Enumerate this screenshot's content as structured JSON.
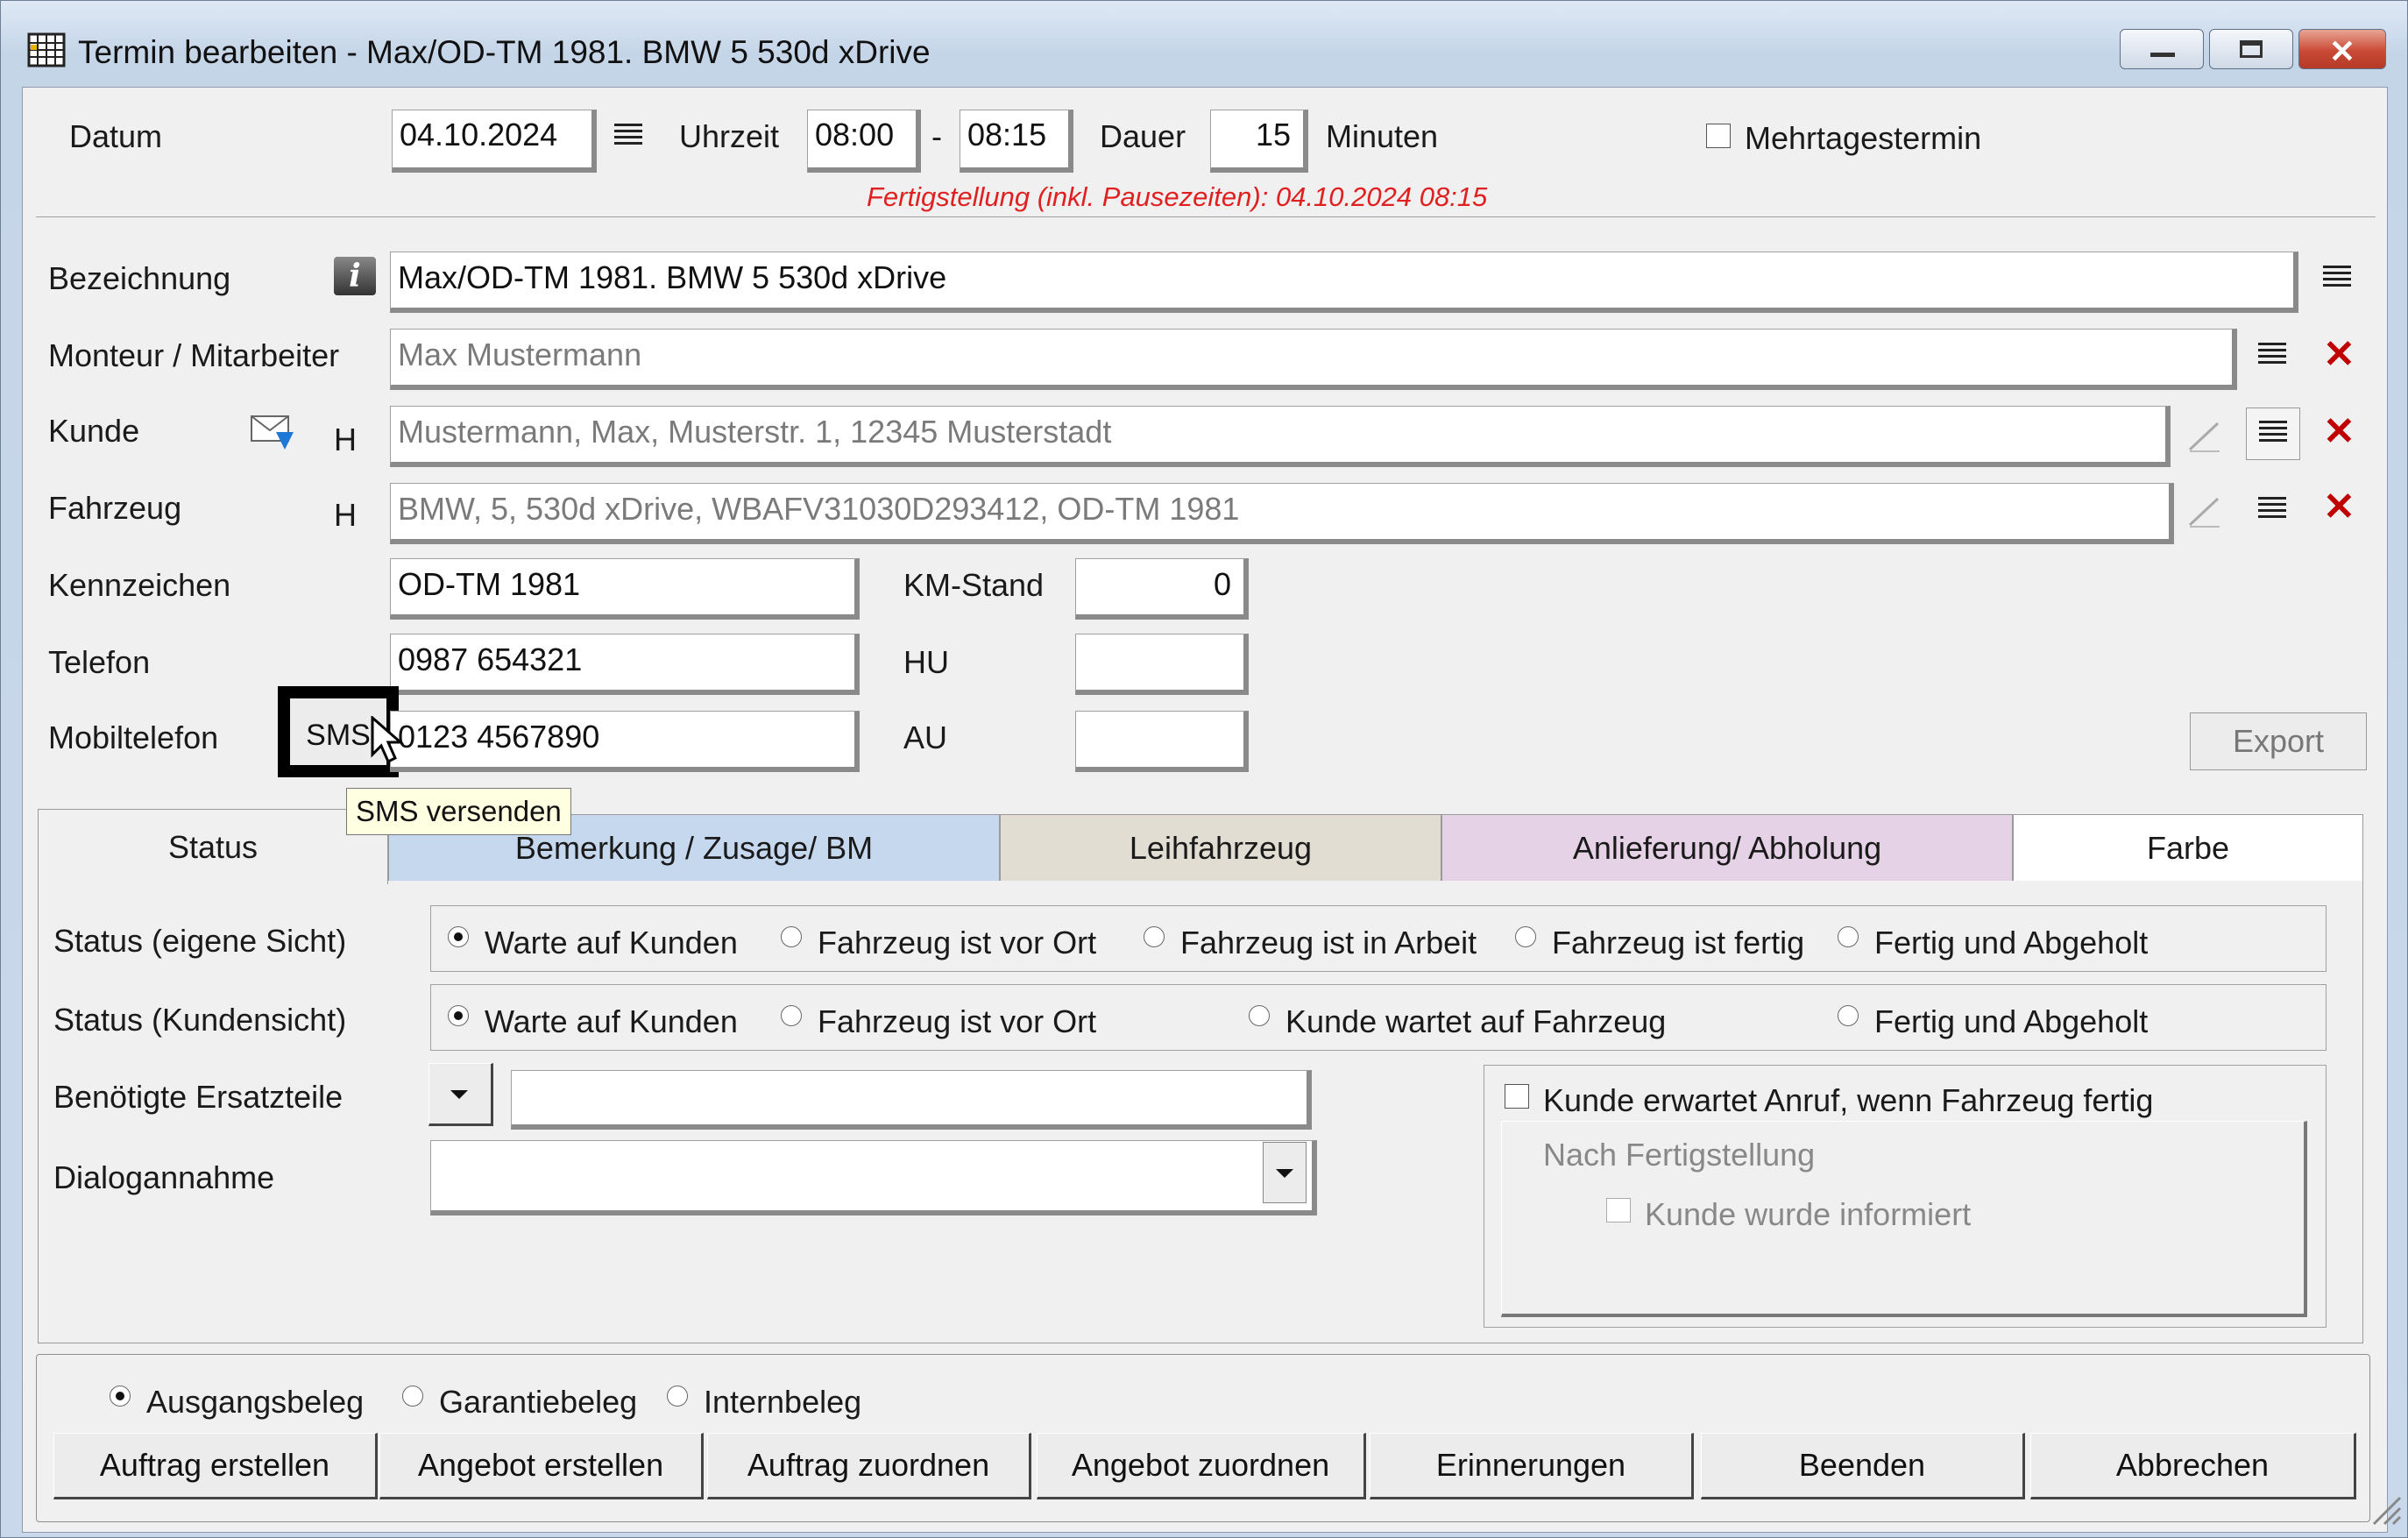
{
  "window": {
    "title": "Termin bearbeiten - Max/OD-TM 1981. BMW 5 530d xDrive"
  },
  "top": {
    "datum_label": "Datum",
    "datum_value": "04.10.2024",
    "uhrzeit_label": "Uhrzeit",
    "time_from": "08:00",
    "dash": "-",
    "time_to": "08:15",
    "dauer_label": "Dauer",
    "dauer_value": "15",
    "minuten_label": "Minuten",
    "mehrtages_label": "Mehrtagestermin",
    "fertigstellung": "Fertigstellung (inkl. Pausezeiten): 04.10.2024 08:15"
  },
  "form": {
    "bezeichnung_label": "Bezeichnung",
    "bezeichnung_value": "Max/OD-TM 1981. BMW 5 530d xDrive",
    "monteur_label": "Monteur / Mitarbeiter",
    "monteur_value": "Max Mustermann",
    "kunde_label": "Kunde",
    "kunde_h": "H",
    "kunde_value": "Mustermann, Max, Musterstr. 1, 12345 Musterstadt",
    "fahrzeug_label": "Fahrzeug",
    "fahrzeug_h": "H",
    "fahrzeug_value": "BMW, 5, 530d xDrive, WBAFV31030D293412, OD-TM 1981",
    "kennzeichen_label": "Kennzeichen",
    "kennzeichen_value": "OD-TM 1981",
    "kmstand_label": "KM-Stand",
    "kmstand_value": "0",
    "telefon_label": "Telefon",
    "telefon_value": "0987 654321",
    "hu_label": "HU",
    "mobil_label": "Mobiltelefon",
    "sms_button": "SMS",
    "mobil_value": "0123 4567890",
    "au_label": "AU",
    "export_button": "Export",
    "tooltip": "SMS versenden"
  },
  "tabs": [
    {
      "label": "Status",
      "color": "#f0f0f0"
    },
    {
      "label": "Bemerkung / Zusage/ BM",
      "color": "#c5d8ee"
    },
    {
      "label": "Leihfahrzeug",
      "color": "#e2ddd2"
    },
    {
      "label": "Anlieferung/ Abholung",
      "color": "#e6d2e6"
    },
    {
      "label": "Farbe",
      "color": "#ffffff"
    }
  ],
  "status": {
    "eigene_label": "Status (eigene Sicht)",
    "eigene_options": [
      "Warte auf Kunden",
      "Fahrzeug ist vor Ort",
      "Fahrzeug ist in Arbeit",
      "Fahrzeug ist fertig",
      "Fertig und Abgeholt"
    ],
    "kunden_label": "Status (Kundensicht)",
    "kunden_options": [
      "Warte auf Kunden",
      "Fahrzeug ist vor Ort",
      "Kunde wartet auf Fahrzeug",
      "Fertig und Abgeholt"
    ],
    "ersatzteile_label": "Benötigte Ersatzteile",
    "dialog_label": "Dialogannahme",
    "anruf_label": "Kunde erwartet Anruf, wenn Fahrzeug fertig",
    "nach_label": "Nach Fertigstellung",
    "informiert_label": "Kunde wurde informiert"
  },
  "bottom": {
    "beleg_options": [
      "Ausgangsbeleg",
      "Garantiebeleg",
      "Internbeleg"
    ],
    "buttons": [
      "Auftrag erstellen",
      "Angebot erstellen",
      "Auftrag zuordnen",
      "Angebot zuordnen",
      "Erinnerungen",
      "Beenden",
      "Abbrechen"
    ]
  },
  "colors": {
    "error_red": "#e02020",
    "accent_red_x": "#c00000"
  }
}
